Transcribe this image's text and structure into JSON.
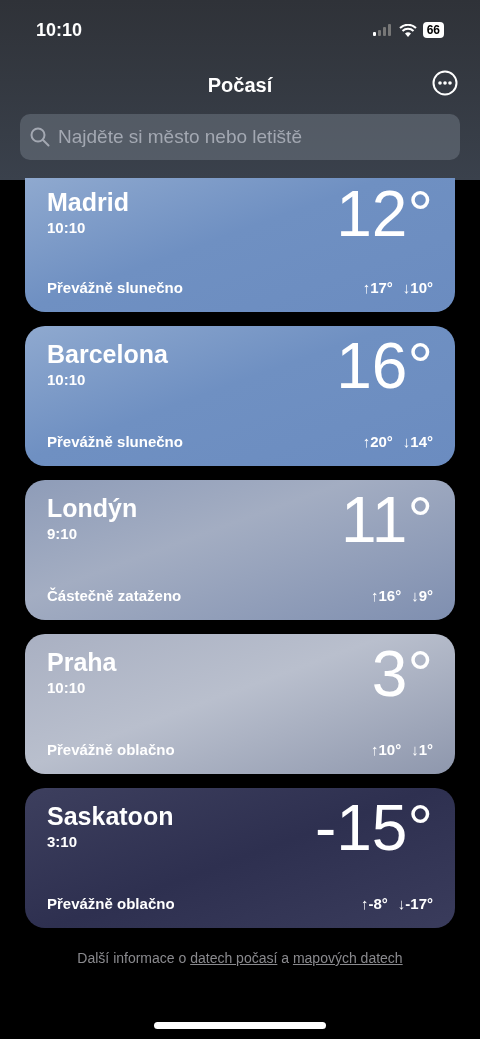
{
  "status_bar": {
    "time": "10:10",
    "battery": "66"
  },
  "header": {
    "title": "Počasí"
  },
  "search": {
    "placeholder": "Najděte si město nebo letiště"
  },
  "locations": [
    {
      "city": "Madrid",
      "time": "10:10",
      "temperature": "12°",
      "condition": "Převážně slunečno",
      "high": "↑17°",
      "low": "↓10°",
      "kind": "sunny"
    },
    {
      "city": "Barcelona",
      "time": "10:10",
      "temperature": "16°",
      "condition": "Převážně slunečno",
      "high": "↑20°",
      "low": "↓14°",
      "kind": "sunny"
    },
    {
      "city": "Londýn",
      "time": "9:10",
      "temperature": "11°",
      "condition": "Částečně zataženo",
      "high": "↑16°",
      "low": "↓9°",
      "kind": "partly_cloudy"
    },
    {
      "city": "Praha",
      "time": "10:10",
      "temperature": "3°",
      "condition": "Převážně oblačno",
      "high": "↑10°",
      "low": "↓1°",
      "kind": "cloudy"
    },
    {
      "city": "Saskatoon",
      "time": "3:10",
      "temperature": "-15°",
      "condition": "Převážně oblačno",
      "high": "↑-8°",
      "low": "↓-17°",
      "kind": "night"
    }
  ],
  "footer": {
    "text_before": "Další informace o",
    "link_1": "datech počasí",
    "text_middle": "a",
    "link_2": "mapových datech"
  }
}
